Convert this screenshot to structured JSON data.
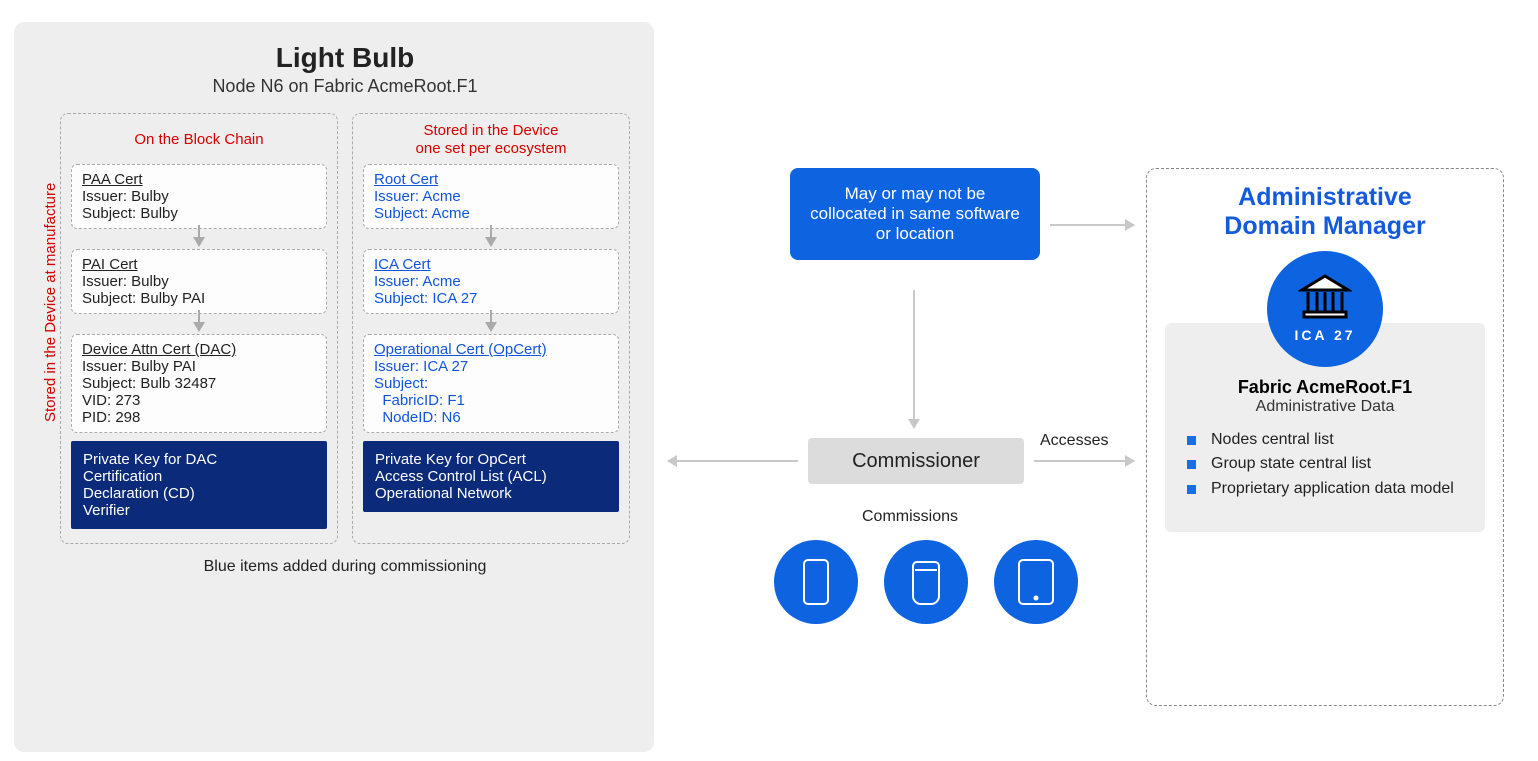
{
  "light_bulb": {
    "title": "Light Bulb",
    "subtitle": "Node N6 on Fabric AcmeRoot.F1",
    "side_label": "Stored in the Device at manufacture",
    "footer": "Blue items added during commissioning",
    "col_left": {
      "heading": "On the Block Chain",
      "paa": {
        "title": "PAA Cert",
        "l1": "Issuer: Bulby",
        "l2": "Subject: Bulby"
      },
      "pai": {
        "title": "PAI Cert",
        "l1": "Issuer: Bulby",
        "l2": "Subject: Bulby PAI"
      },
      "dac": {
        "title": "Device Attn Cert (DAC)",
        "l1": "Issuer: Bulby PAI",
        "l2": "Subject: Bulb 32487",
        "l3": "VID: 273",
        "l4": "PID: 298"
      },
      "priv": {
        "l1": "Private Key for DAC",
        "l2": "Certification",
        "l3": "Declaration (CD)",
        "l4": "Verifier"
      }
    },
    "col_right": {
      "heading_l1": "Stored in the Device",
      "heading_l2": "one set per ecosystem",
      "root": {
        "title": "Root Cert",
        "l1": "Issuer: Acme",
        "l2": "Subject: Acme"
      },
      "ica": {
        "title": "ICA Cert",
        "l1": "Issuer: Acme",
        "l2": "Subject: ICA 27"
      },
      "opcert": {
        "title": "Operational Cert (OpCert)",
        "l1": "Issuer: ICA 27",
        "l2": "Subject:",
        "l3": "  FabricID: F1",
        "l4": "  NodeID: N6"
      },
      "priv": {
        "l1": "Private Key for OpCert",
        "l2": "Access Control List (ACL)",
        "l3": "Operational Network"
      }
    }
  },
  "mid": {
    "note": "May or may not be collocated in same software or location",
    "commissioner": "Commissioner",
    "accesses": "Accesses",
    "commissions": "Commissions"
  },
  "admin": {
    "title_l1": "Administrative",
    "title_l2": "Domain Manager",
    "badge_label": "ICA 27",
    "fabric_name": "Fabric AcmeRoot.F1",
    "fabric_sub": "Administrative Data",
    "bullets": [
      "Nodes central list",
      "Group state central list",
      "Proprietary application data model"
    ]
  }
}
